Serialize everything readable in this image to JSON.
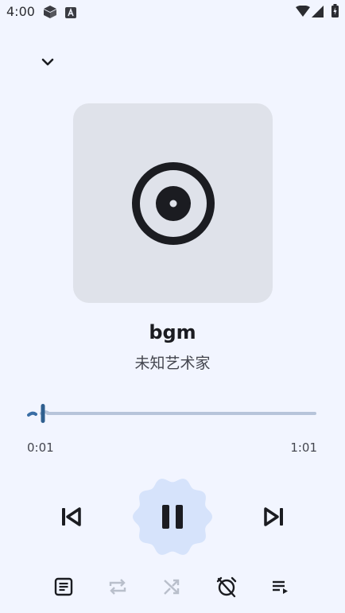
{
  "status_bar": {
    "time": "4:00",
    "left_icons": [
      "cube-icon",
      "a-badge-icon"
    ],
    "right_icons": [
      "wifi-icon",
      "signal-icon",
      "battery-icon"
    ]
  },
  "header": {
    "collapse_icon": "chevron-down-icon"
  },
  "artwork": {
    "icon": "vinyl-disc-icon"
  },
  "track": {
    "title": "bgm",
    "artist": "未知艺术家"
  },
  "progress": {
    "current": "0:01",
    "total": "1:01",
    "fraction": 0.016
  },
  "controls": {
    "previous_icon": "skip-previous-icon",
    "play_pause_icon": "pause-icon",
    "next_icon": "skip-next-icon"
  },
  "bottom_bar": {
    "items": [
      {
        "icon": "lyrics-icon",
        "enabled": true
      },
      {
        "icon": "repeat-icon",
        "enabled": false
      },
      {
        "icon": "shuffle-icon",
        "enabled": false
      },
      {
        "icon": "alarm-off-icon",
        "enabled": true
      },
      {
        "icon": "queue-icon",
        "enabled": true
      }
    ]
  },
  "colors": {
    "background": "#f2f5ff",
    "artwork_bg": "#dfe2ea",
    "accent": "#3a6ea5",
    "play_button_bg": "#d6e3fb",
    "icon_dark": "#1b1c21",
    "icon_disabled": "#b9bfcb"
  }
}
